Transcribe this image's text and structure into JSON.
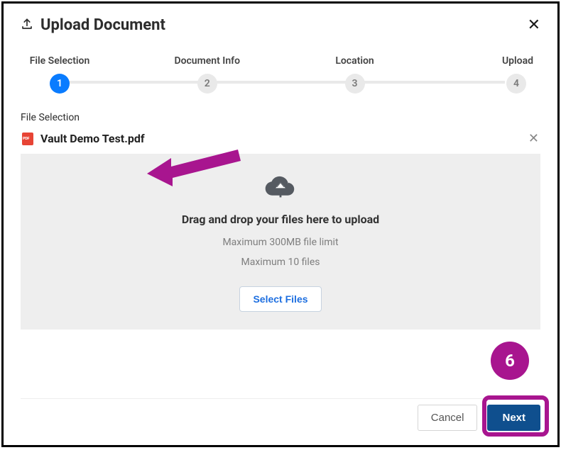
{
  "header": {
    "title": "Upload Document"
  },
  "steps": [
    {
      "label": "File Selection",
      "number": "1"
    },
    {
      "label": "Document Info",
      "number": "2"
    },
    {
      "label": "Location",
      "number": "3"
    },
    {
      "label": "Upload",
      "number": "4"
    }
  ],
  "section": {
    "label": "File Selection"
  },
  "files": [
    {
      "name": "Vault Demo Test.pdf"
    }
  ],
  "dropzone": {
    "title": "Drag and drop your files here to upload",
    "hint1": "Maximum 300MB file limit",
    "hint2": "Maximum 10 files",
    "select_label": "Select Files"
  },
  "footer": {
    "cancel_label": "Cancel",
    "next_label": "Next"
  },
  "annotation": {
    "badge_number": "6"
  }
}
